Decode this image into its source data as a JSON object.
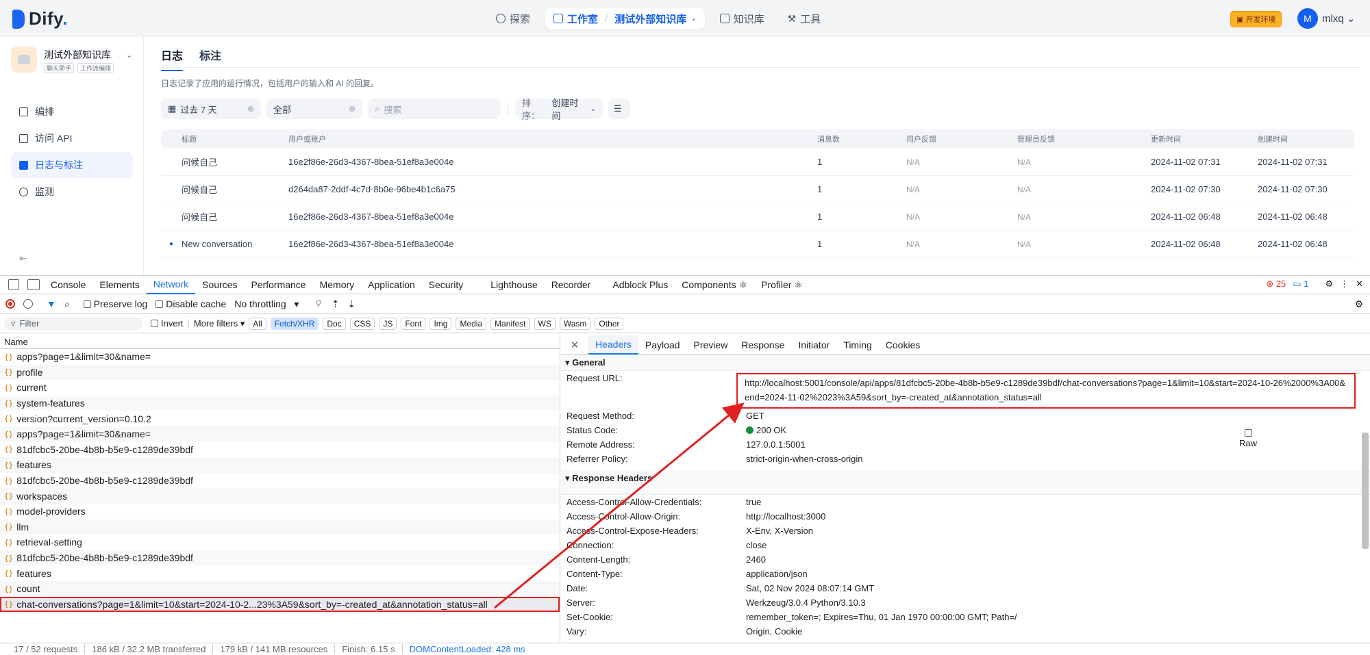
{
  "topbar": {
    "logo": "Dify",
    "nav": {
      "explore": "探索",
      "studio": "工作室",
      "current_app": "测试外部知识库",
      "knowledge": "知识库",
      "tools": "工具"
    },
    "env_badge": "开发环境",
    "avatar_letter": "M",
    "user_name": "mlxq"
  },
  "sidebar": {
    "app_name": "测试外部知识库",
    "tags": [
      "聊天助手",
      "工作流编排"
    ],
    "items": [
      {
        "label": "编排"
      },
      {
        "label": "访问 API"
      },
      {
        "label": "日志与标注"
      },
      {
        "label": "监测"
      }
    ]
  },
  "logs": {
    "tabs": [
      "日志",
      "标注"
    ],
    "description": "日志记录了应用的运行情况，包括用户的输入和 AI 的回复。",
    "filters": {
      "period": "过去 7 天",
      "status": "全部",
      "search_placeholder": "搜索",
      "sort_label": "排序：",
      "sort_value": "创建时间"
    },
    "columns": [
      "标题",
      "用户或账户",
      "消息数",
      "用户反馈",
      "管理员反馈",
      "更新时间",
      "创建时间"
    ],
    "rows": [
      {
        "title": "问候自己",
        "user": "16e2f86e-26d3-4367-8bea-51ef8a3e004e",
        "count": "1",
        "user_fb": "N/A",
        "admin_fb": "N/A",
        "updated": "2024-11-02 07:31",
        "created": "2024-11-02 07:31"
      },
      {
        "title": "问候自己",
        "user": "d264da87-2ddf-4c7d-8b0e-96be4b1c6a75",
        "count": "1",
        "user_fb": "N/A",
        "admin_fb": "N/A",
        "updated": "2024-11-02 07:30",
        "created": "2024-11-02 07:30"
      },
      {
        "title": "问候自己",
        "user": "16e2f86e-26d3-4367-8bea-51ef8a3e004e",
        "count": "1",
        "user_fb": "N/A",
        "admin_fb": "N/A",
        "updated": "2024-11-02 06:48",
        "created": "2024-11-02 06:48"
      },
      {
        "title": "New conversation",
        "user": "16e2f86e-26d3-4367-8bea-51ef8a3e004e",
        "count": "1",
        "user_fb": "N/A",
        "admin_fb": "N/A",
        "updated": "2024-11-02 06:48",
        "created": "2024-11-02 06:48"
      }
    ]
  },
  "devtools": {
    "tabs": [
      "Console",
      "Elements",
      "Network",
      "Sources",
      "Performance",
      "Memory",
      "Application",
      "Security",
      "Lighthouse",
      "Recorder",
      "Adblock Plus",
      "Components ⚛",
      "Profiler ⚛"
    ],
    "error_count": "25",
    "message_count": "1",
    "toolbar": {
      "preserve_log": "Preserve log",
      "disable_cache": "Disable cache",
      "throttling": "No throttling"
    },
    "filter_placeholder": "Filter",
    "invert": "Invert",
    "more_filters": "More filters",
    "type_chips": [
      "All",
      "Fetch/XHR",
      "Doc",
      "CSS",
      "JS",
      "Font",
      "Img",
      "Media",
      "Manifest",
      "WS",
      "Wasm",
      "Other"
    ],
    "name_header": "Name",
    "requests": [
      "apps?page=1&limit=30&name=",
      "profile",
      "current",
      "system-features",
      "version?current_version=0.10.2",
      "apps?page=1&limit=30&name=",
      "81dfcbc5-20be-4b8b-b5e9-c1289de39bdf",
      "features",
      "81dfcbc5-20be-4b8b-b5e9-c1289de39bdf",
      "workspaces",
      "model-providers",
      "llm",
      "retrieval-setting",
      "81dfcbc5-20be-4b8b-b5e9-c1289de39bdf",
      "features",
      "count",
      "chat-conversations?page=1&limit=10&start=2024-10-2...23%3A59&sort_by=-created_at&annotation_status=all"
    ],
    "detail_tabs": [
      "Headers",
      "Payload",
      "Preview",
      "Response",
      "Initiator",
      "Timing",
      "Cookies"
    ],
    "general_title": "▾ General",
    "general": [
      {
        "k": "Request URL:",
        "v": "http://localhost:5001/console/api/apps/81dfcbc5-20be-4b8b-b5e9-c1289de39bdf/chat-conversations?page=1&limit=10&start=2024-10-26%2000%3A00&end=2024-11-02%2023%3A59&sort_by=-created_at&annotation_status=all"
      },
      {
        "k": "Request Method:",
        "v": "GET"
      },
      {
        "k": "Status Code:",
        "v": "200 OK"
      },
      {
        "k": "Remote Address:",
        "v": "127.0.0.1:5001"
      },
      {
        "k": "Referrer Policy:",
        "v": "strict-origin-when-cross-origin"
      }
    ],
    "response_title": "▾ Response Headers",
    "raw_label": "Raw",
    "response": [
      {
        "k": "Access-Control-Allow-Credentials:",
        "v": "true"
      },
      {
        "k": "Access-Control-Allow-Origin:",
        "v": "http://localhost:3000"
      },
      {
        "k": "Access-Control-Expose-Headers:",
        "v": "X-Env, X-Version"
      },
      {
        "k": "Connection:",
        "v": "close"
      },
      {
        "k": "Content-Length:",
        "v": "2460"
      },
      {
        "k": "Content-Type:",
        "v": "application/json"
      },
      {
        "k": "Date:",
        "v": "Sat, 02 Nov 2024 08:07:14 GMT"
      },
      {
        "k": "Server:",
        "v": "Werkzeug/3.0.4 Python/3.10.3"
      },
      {
        "k": "Set-Cookie:",
        "v": "remember_token=; Expires=Thu, 01 Jan 1970 00:00:00 GMT; Path=/"
      },
      {
        "k": "Vary:",
        "v": "Origin, Cookie"
      }
    ],
    "status": {
      "requests": "17 / 52 requests",
      "transferred": "186 kB / 32.2 MB transferred",
      "resources": "179 kB / 141 MB resources",
      "finish": "Finish: 6.15 s",
      "dcl": "DOMContentLoaded: 428 ms"
    }
  }
}
